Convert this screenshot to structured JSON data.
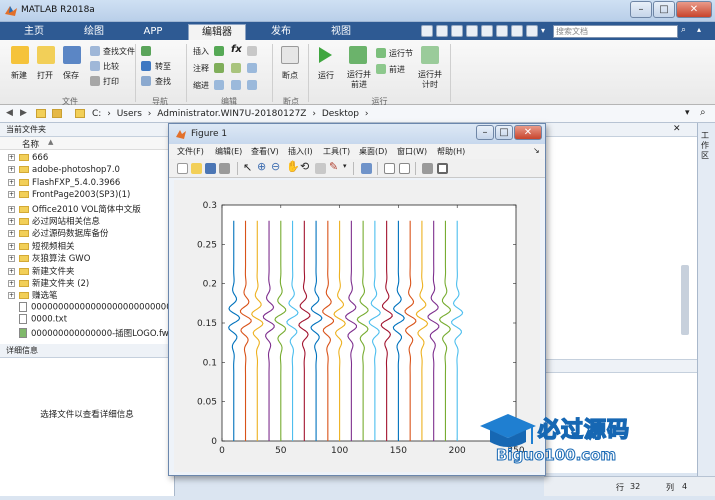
{
  "app": {
    "title": "MATLAB R2018a"
  },
  "tabs": [
    "主页",
    "绘图",
    "APP",
    "编辑器",
    "发布",
    "视图"
  ],
  "search": {
    "placeholder": "搜索文档"
  },
  "ribbon": {
    "file_group": {
      "label": "文件",
      "buttons": [
        "新建",
        "打开",
        "保存"
      ],
      "small": [
        "查找文件",
        "比较",
        "打印"
      ]
    },
    "nav_group": {
      "label": "导航",
      "small": [
        "转至",
        "查找"
      ]
    },
    "edit_group": {
      "label": "编辑",
      "rows": [
        "插入",
        "注释",
        "缩进"
      ]
    },
    "breakpoint_group": {
      "label": "断点",
      "button": "断点"
    },
    "run_group": {
      "label": "运行",
      "buttons": [
        "运行",
        "运行并前进",
        "运行并计时"
      ],
      "small": [
        "运行节",
        "前进"
      ]
    }
  },
  "address": {
    "path": [
      "C:",
      "Users",
      "Administrator.WIN7U-20180127Z",
      "Desktop"
    ]
  },
  "left_panel": {
    "header": "当前文件夹",
    "column_name": "名称",
    "files": [
      {
        "name": "666",
        "type": "folder"
      },
      {
        "name": "adobe-photoshop7.0",
        "type": "folder"
      },
      {
        "name": "FlashFXP_5.4.0.3966",
        "type": "folder"
      },
      {
        "name": "FrontPage2003(SP3)(1)",
        "type": "folder"
      },
      {
        "name": "Office2010 VOL简体中文版",
        "type": "folder"
      },
      {
        "name": "必过网站相关信息",
        "type": "folder"
      },
      {
        "name": "必过源码数据库备份",
        "type": "folder"
      },
      {
        "name": "短视频相关",
        "type": "folder"
      },
      {
        "name": "灰狼算法 GWO",
        "type": "folder"
      },
      {
        "name": "新建文件夹",
        "type": "folder"
      },
      {
        "name": "新建文件夹 (2)",
        "type": "folder"
      },
      {
        "name": "赚选笔",
        "type": "folder"
      },
      {
        "name": "000000000000000000000000000...",
        "type": "file"
      },
      {
        "name": "0000.txt",
        "type": "file"
      },
      {
        "name": "000000000000000-插图LOGO.fw.p...",
        "type": "image"
      }
    ],
    "details_header": "详细信息",
    "details_text": "选择文件以查看详细信息"
  },
  "figure": {
    "title": "Figure 1",
    "menu": [
      "文件(F)",
      "编辑(E)",
      "查看(V)",
      "插入(I)",
      "工具(T)",
      "桌面(D)",
      "窗口(W)",
      "帮助(H)"
    ]
  },
  "workspace_tab": "工作区",
  "status": {
    "row_label": "行",
    "row": "32",
    "col_label": "列",
    "col": "4"
  },
  "watermark": {
    "brand": "必过源码",
    "url": "Biguo100.com"
  },
  "colors": {
    "tab_bar": "#2e5a93",
    "accent": "#1f7fd1"
  },
  "chart_data": {
    "type": "line",
    "title": "",
    "xlabel": "",
    "ylabel": "",
    "xlim": [
      0,
      250
    ],
    "ylim": [
      0,
      0.3
    ],
    "x_ticks": [
      0,
      50,
      100,
      150,
      200,
      250
    ],
    "y_ticks": [
      0,
      0.05,
      0.1,
      0.15,
      0.2,
      0.25,
      0.3
    ],
    "series_offsets": [
      10,
      20,
      30,
      40,
      50,
      60,
      70,
      80,
      90,
      100,
      110,
      120,
      130,
      140,
      150,
      160,
      170,
      180,
      190,
      200
    ],
    "series_colors": [
      "#0072bd",
      "#d95319",
      "#edb120",
      "#7e2f8e",
      "#77ac30",
      "#4dbeee",
      "#a2142f"
    ],
    "y_range": [
      0,
      0.28
    ]
  }
}
